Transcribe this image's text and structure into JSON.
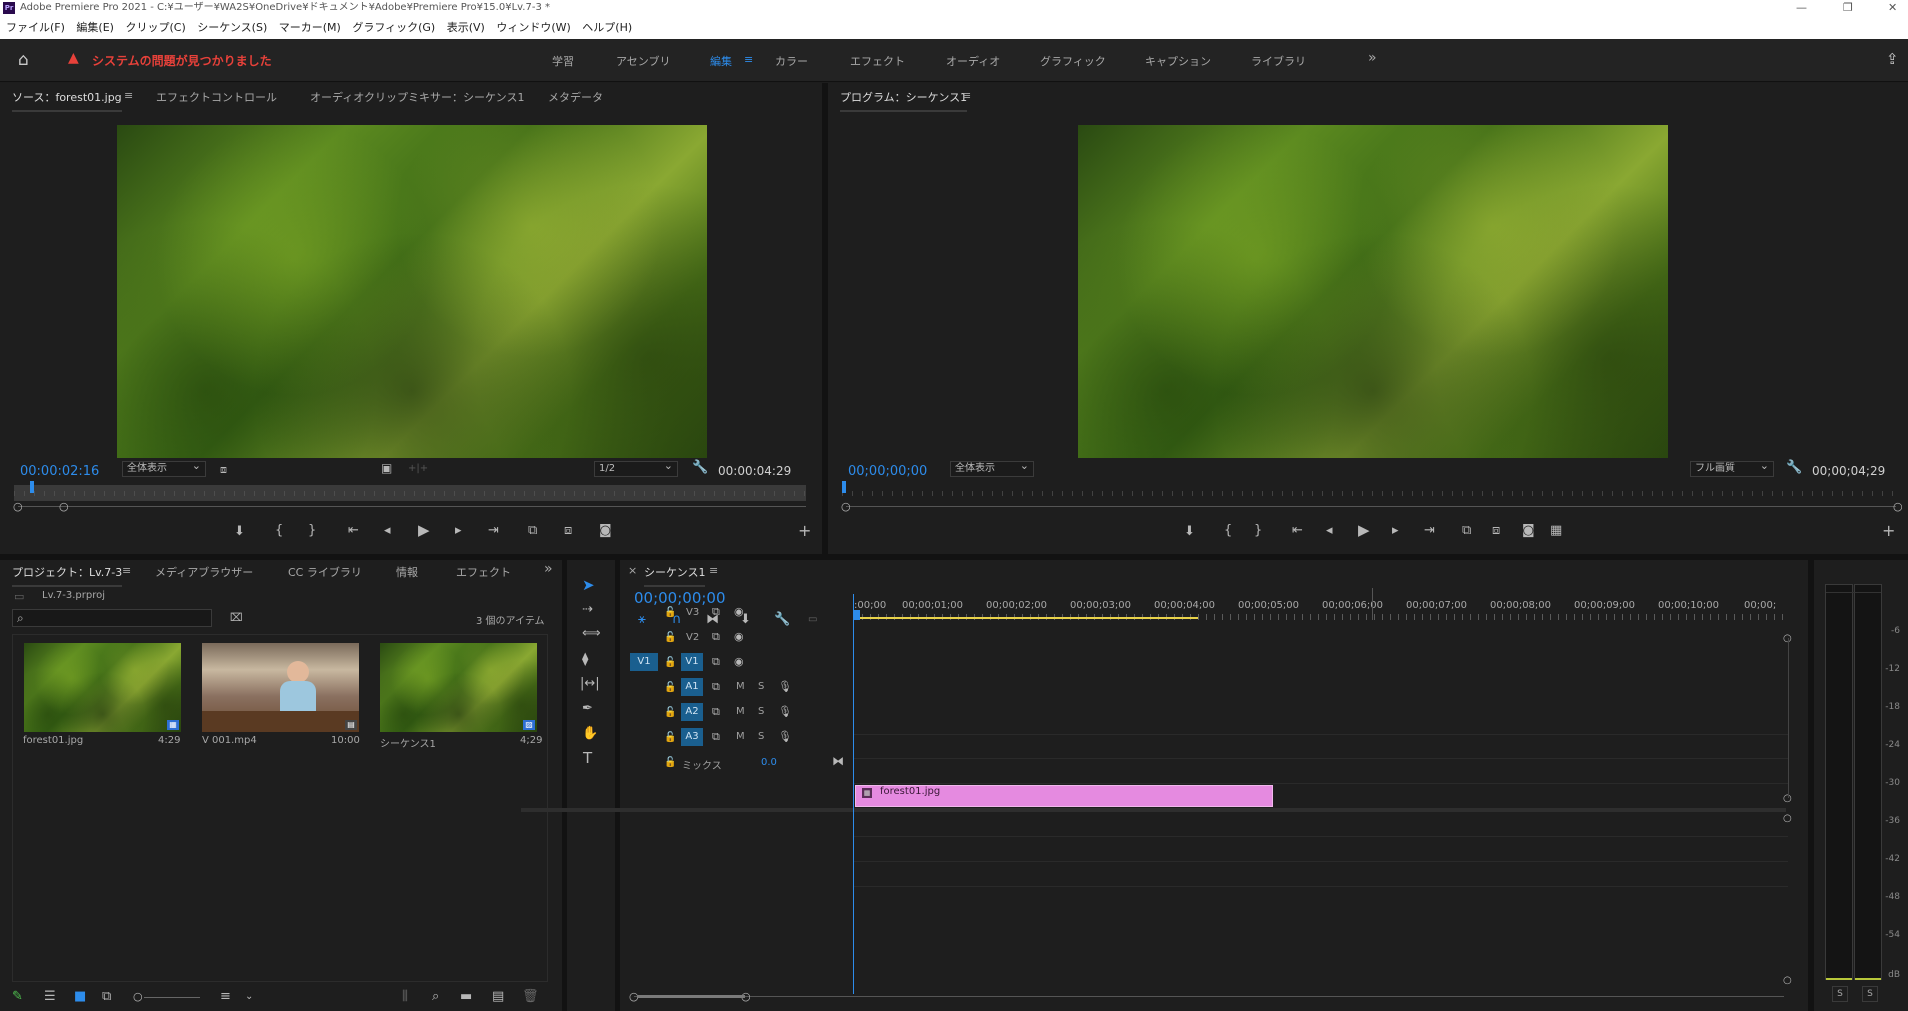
{
  "title_bar": {
    "app_icon": "Pr",
    "text": "Adobe Premiere Pro 2021 - C:¥ユーザー¥WA2S¥OneDrive¥ドキュメント¥Adobe¥Premiere Pro¥15.0¥Lv.7-3 *"
  },
  "menu": [
    "ファイル(F)",
    "編集(E)",
    "クリップ(C)",
    "シーケンス(S)",
    "マーカー(M)",
    "グラフィック(G)",
    "表示(V)",
    "ウィンドウ(W)",
    "ヘルプ(H)"
  ],
  "alert": "システムの問題が見つかりました",
  "workspaces": [
    "学習",
    "アセンブリ",
    "編集",
    "カラー",
    "エフェクト",
    "オーディオ",
    "グラフィック",
    "キャプション",
    "ライブラリ"
  ],
  "workspace_more": "»",
  "source_panel": {
    "tabs": [
      "ソース：forest01.jpg",
      "エフェクトコントロール",
      "オーディオクリップミキサー：シーケンス1",
      "メタデータ"
    ],
    "menu_glyph": "≡",
    "timecode": "00:00:02:16",
    "zoom": "全体表示",
    "resolution": "1/2",
    "duration": "00:00:04:29",
    "playhead_fraction": 0.02
  },
  "program_panel": {
    "tab": "プログラム：シーケンス1",
    "menu_glyph": "≡",
    "timecode": "00;00;00;00",
    "zoom": "全体表示",
    "quality": "フル画質",
    "duration": "00;00;04;29"
  },
  "project_panel": {
    "tabs": [
      "プロジェクト：Lv.7-3",
      "メディアブラウザー",
      "CC ライブラリ",
      "情報",
      "エフェクト"
    ],
    "more": "»",
    "file": "Lv.7-3.prproj",
    "item_count": "3 個のアイテム",
    "items": [
      {
        "name": "forest01.jpg",
        "duration": "4:29"
      },
      {
        "name": "V 001.mp4",
        "duration": "10:00"
      },
      {
        "name": "シーケンス1",
        "duration": "4;29"
      }
    ]
  },
  "timeline": {
    "close": "×",
    "tab": "シーケンス1",
    "menu_glyph": "≡",
    "timecode": "00;00;00;00",
    "ruler": [
      ":00;00",
      "00;00;01;00",
      "00;00;02;00",
      "00;00;03;00",
      "00;00;04;00",
      "00;00;05;00",
      "00;00;06;00",
      "00;00;07;00",
      "00;00;08;00",
      "00;00;09;00",
      "00;00;10;00",
      "00;00;"
    ],
    "video_tracks": [
      "V3",
      "V2",
      "V1"
    ],
    "audio_tracks": [
      "A1",
      "A2",
      "A3"
    ],
    "source_patch": "V1",
    "mute_label": "M",
    "solo_label": "S",
    "mix_label": "ミックス",
    "mix_value": "0.0",
    "clip": {
      "name": "forest01.jpg",
      "color": "#e58ae0"
    }
  },
  "audio_meter": {
    "ticks": [
      "-6",
      "-12",
      "-18",
      "-24",
      "-30",
      "-36",
      "-42",
      "-48",
      "-54",
      "dB"
    ],
    "solo_buttons": [
      "S",
      "S"
    ]
  }
}
